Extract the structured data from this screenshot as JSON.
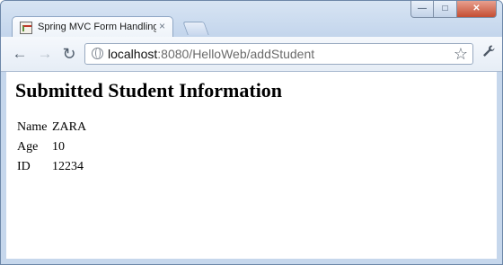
{
  "browser": {
    "tab": {
      "title": "Spring MVC Form Handling",
      "close": "×"
    },
    "window_controls": {
      "minimize": "—",
      "maximize": "□",
      "close": "✕"
    },
    "toolbar": {
      "back": "←",
      "forward": "→",
      "reload": "↻",
      "url_host": "localhost",
      "url_rest": ":8080/HelloWeb/addStudent",
      "bookmark": "☆",
      "menu": "🔧"
    },
    "icons": {
      "favicon": "spring-favicon-icon",
      "globe": "globe-icon",
      "star": "star-icon",
      "wrench": "wrench-icon"
    }
  },
  "page": {
    "heading": "Submitted Student Information",
    "rows": [
      {
        "label": "Name",
        "value": "ZARA"
      },
      {
        "label": "Age",
        "value": "10"
      },
      {
        "label": "ID",
        "value": "12234"
      }
    ]
  }
}
